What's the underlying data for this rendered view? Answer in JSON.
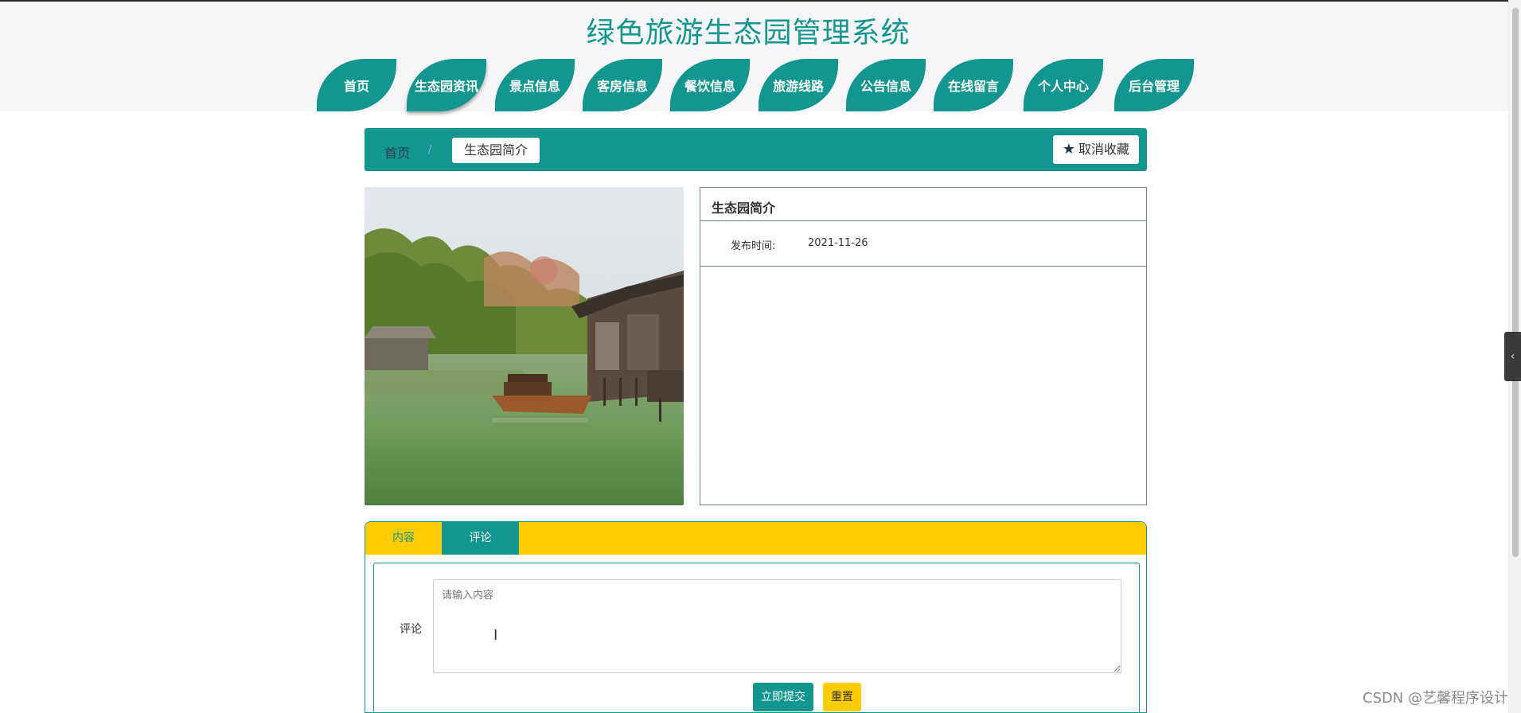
{
  "header": {
    "site_title": "绿色旅游生态园管理系统"
  },
  "nav": {
    "items": [
      {
        "label": "首页"
      },
      {
        "label": "生态园资讯"
      },
      {
        "label": "景点信息"
      },
      {
        "label": "客房信息"
      },
      {
        "label": "餐饮信息"
      },
      {
        "label": "旅游线路"
      },
      {
        "label": "公告信息"
      },
      {
        "label": "在线留言"
      },
      {
        "label": "个人中心"
      },
      {
        "label": "后台管理"
      }
    ],
    "active_index": 1
  },
  "breadcrumb": {
    "home": "首页",
    "separator": "/",
    "current": "生态园简介"
  },
  "favorite_button": {
    "icon": "star-icon",
    "label": "取消收藏"
  },
  "detail": {
    "title": "生态园简介",
    "publish_label": "发布时间:",
    "publish_date": "2021-11-26"
  },
  "tabs": {
    "content_label": "内容",
    "comment_label": "评论"
  },
  "comment_form": {
    "label": "评论",
    "placeholder": "请输入内容",
    "submit_label": "立即提交",
    "reset_label": "重置"
  },
  "watermark": "CSDN @艺馨程序设计",
  "colors": {
    "primary": "#13968f",
    "accent": "#ffcc00",
    "header_bg": "#f6f5f8"
  }
}
